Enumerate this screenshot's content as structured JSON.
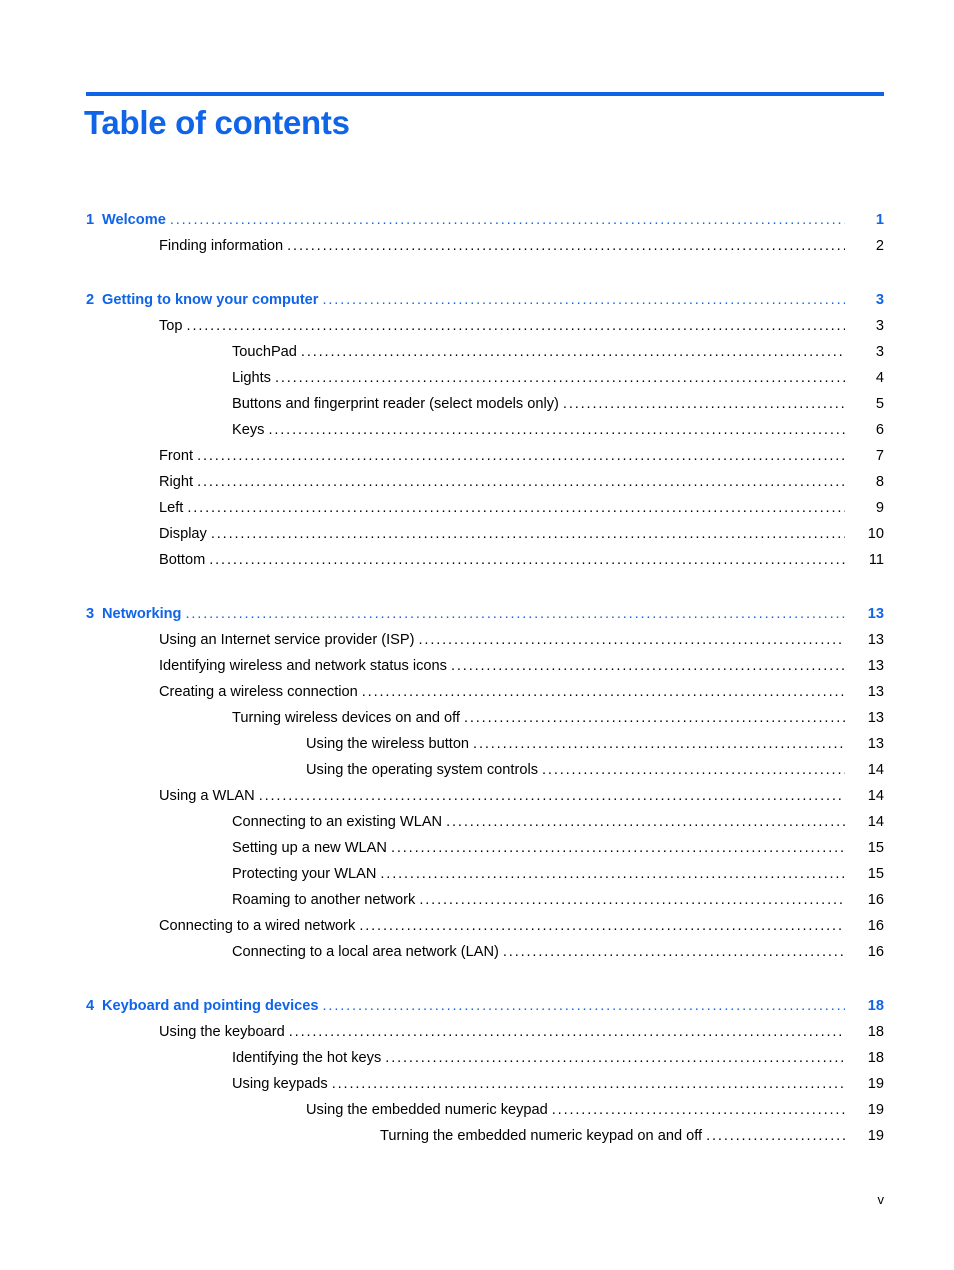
{
  "document": {
    "title": "Table of contents",
    "folio": "v",
    "accent_color": "#0F64E8",
    "text_color": "#000000"
  },
  "toc": {
    "entries": [
      {
        "level": "chapter",
        "number": "1",
        "label": "Welcome",
        "page": "1",
        "gap_before": false
      },
      {
        "level": "1",
        "number": "",
        "label": "Finding information",
        "page": "2",
        "gap_before": false
      },
      {
        "level": "chapter",
        "number": "2",
        "label": "Getting to know your computer",
        "page": "3",
        "gap_before": true
      },
      {
        "level": "1",
        "number": "",
        "label": "Top",
        "page": "3",
        "gap_before": false
      },
      {
        "level": "2",
        "number": "",
        "label": "TouchPad",
        "page": "3",
        "gap_before": false
      },
      {
        "level": "2",
        "number": "",
        "label": "Lights",
        "page": "4",
        "gap_before": false
      },
      {
        "level": "2",
        "number": "",
        "label": "Buttons and fingerprint reader (select models only)",
        "page": "5",
        "gap_before": false
      },
      {
        "level": "2",
        "number": "",
        "label": "Keys",
        "page": "6",
        "gap_before": false
      },
      {
        "level": "1",
        "number": "",
        "label": "Front",
        "page": "7",
        "gap_before": false
      },
      {
        "level": "1",
        "number": "",
        "label": "Right",
        "page": "8",
        "gap_before": false
      },
      {
        "level": "1",
        "number": "",
        "label": "Left",
        "page": "9",
        "gap_before": false
      },
      {
        "level": "1",
        "number": "",
        "label": "Display",
        "page": "10",
        "gap_before": false
      },
      {
        "level": "1",
        "number": "",
        "label": "Bottom",
        "page": "11",
        "gap_before": false
      },
      {
        "level": "chapter",
        "number": "3",
        "label": "Networking",
        "page": "13",
        "gap_before": true
      },
      {
        "level": "1",
        "number": "",
        "label": "Using an Internet service provider (ISP)",
        "page": "13",
        "gap_before": false
      },
      {
        "level": "1",
        "number": "",
        "label": "Identifying wireless and network status icons",
        "page": "13",
        "gap_before": false
      },
      {
        "level": "1",
        "number": "",
        "label": "Creating a wireless connection",
        "page": "13",
        "gap_before": false
      },
      {
        "level": "2",
        "number": "",
        "label": "Turning wireless devices on and off",
        "page": "13",
        "gap_before": false
      },
      {
        "level": "3",
        "number": "",
        "label": "Using the wireless button",
        "page": "13",
        "gap_before": false
      },
      {
        "level": "3",
        "number": "",
        "label": "Using the operating system controls",
        "page": "14",
        "gap_before": false
      },
      {
        "level": "1",
        "number": "",
        "label": "Using a WLAN",
        "page": "14",
        "gap_before": false
      },
      {
        "level": "2",
        "number": "",
        "label": "Connecting to an existing WLAN",
        "page": "14",
        "gap_before": false
      },
      {
        "level": "2",
        "number": "",
        "label": "Setting up a new WLAN",
        "page": "15",
        "gap_before": false
      },
      {
        "level": "2",
        "number": "",
        "label": "Protecting your WLAN",
        "page": "15",
        "gap_before": false
      },
      {
        "level": "2",
        "number": "",
        "label": "Roaming to another network",
        "page": "16",
        "gap_before": false
      },
      {
        "level": "1",
        "number": "",
        "label": "Connecting to a wired network",
        "page": "16",
        "gap_before": false
      },
      {
        "level": "2",
        "number": "",
        "label": "Connecting to a local area network (LAN)",
        "page": "16",
        "gap_before": false
      },
      {
        "level": "chapter",
        "number": "4",
        "label": "Keyboard and pointing devices",
        "page": "18",
        "gap_before": true
      },
      {
        "level": "1",
        "number": "",
        "label": "Using the keyboard",
        "page": "18",
        "gap_before": false
      },
      {
        "level": "2",
        "number": "",
        "label": "Identifying the hot keys",
        "page": "18",
        "gap_before": false
      },
      {
        "level": "2",
        "number": "",
        "label": "Using keypads",
        "page": "19",
        "gap_before": false
      },
      {
        "level": "3",
        "number": "",
        "label": "Using the embedded numeric keypad",
        "page": "19",
        "gap_before": false
      },
      {
        "level": "4",
        "number": "",
        "label": "Turning the embedded numeric keypad on and off",
        "page": "19",
        "gap_before": false
      }
    ]
  }
}
